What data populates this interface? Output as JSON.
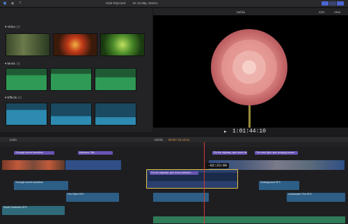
{
  "toolbar": {
    "library_filter": "Hide Rejected",
    "clip_title": "4K 23.98p, Stereo",
    "viewer_label": "Dahlia",
    "zoom": "42%",
    "view_menu": "View"
  },
  "browser": {
    "sections": [
      {
        "label": "Video",
        "count": "(3)"
      },
      {
        "label": "Music",
        "count": "(3)"
      },
      {
        "label": "Effects",
        "count": "(3)"
      }
    ],
    "footer": "3 items"
  },
  "viewer": {
    "timecode": "1:01:44:10"
  },
  "timeline": {
    "index_label": "Index",
    "project_name": "Dahlia",
    "project_duration": "05:10 / 01:14:21",
    "floating_timecode": "-02:23:00",
    "clips": {
      "title1": "Through tunnel transition",
      "title2": "Bauhaus Title",
      "title3": "Fly the highway, spin down between",
      "title4": "The best light, spin bringing rooms",
      "audio1": "Through tunnel transition",
      "audio2": "Underground SFX",
      "audio3": "Fire Wind SFX",
      "audio4": "Underwater Fire SFX",
      "music1": "South Undertow SFX"
    }
  },
  "colors": {
    "accent": "#4c66d6",
    "playhead": "#d23a2f",
    "title_clip": "#6a55b5"
  }
}
